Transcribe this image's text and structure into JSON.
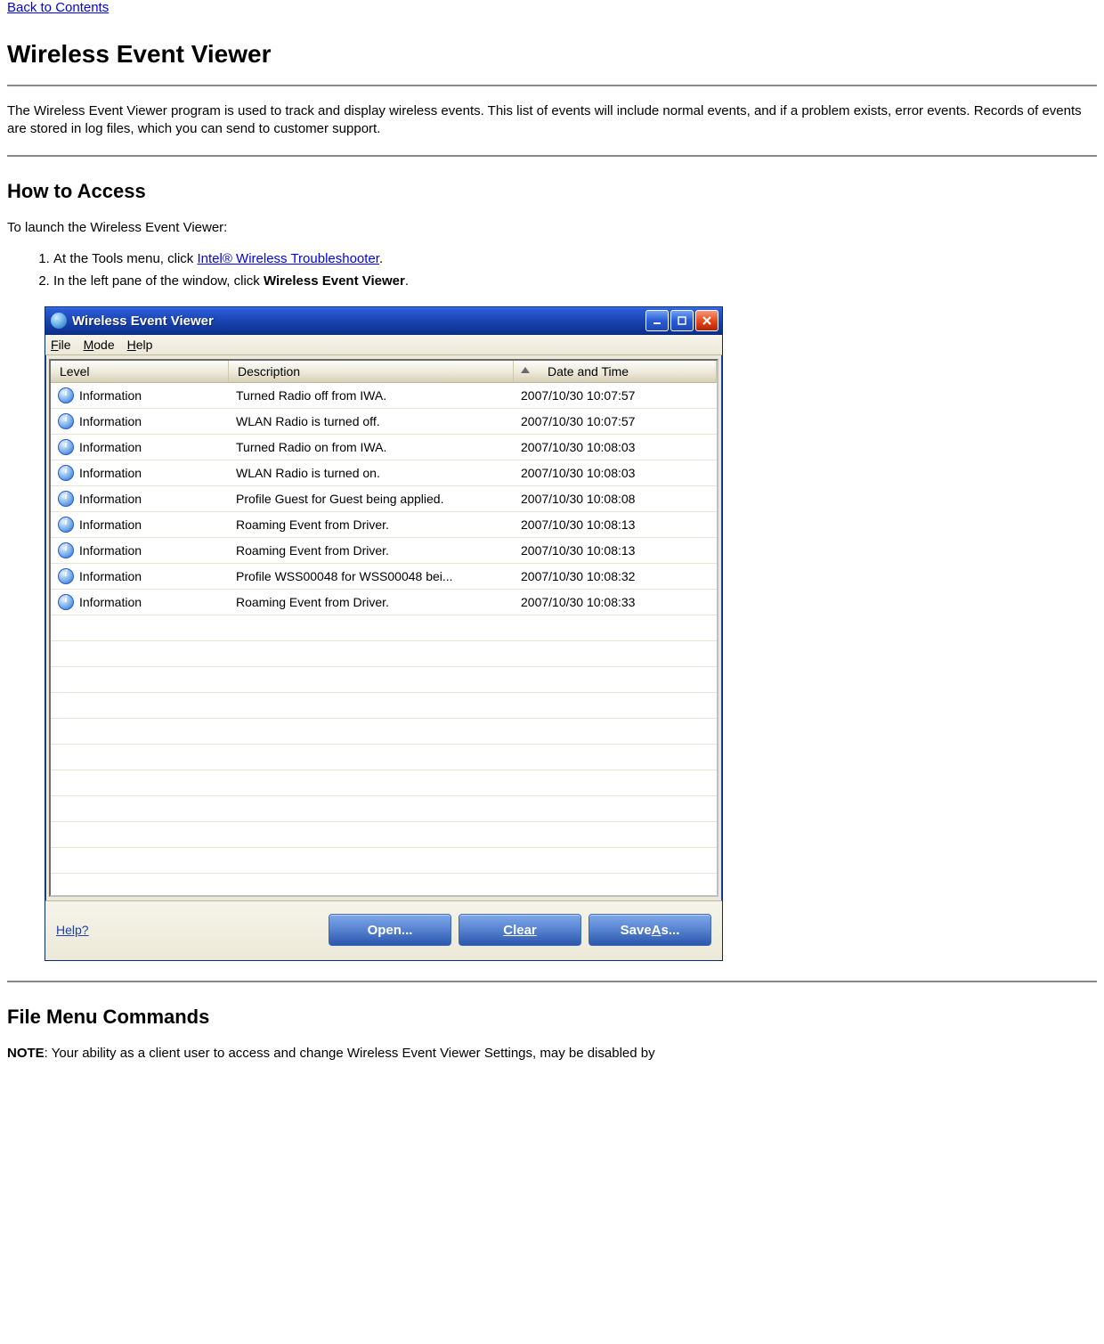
{
  "nav": {
    "back_link": "Back to Contents"
  },
  "h1": "Wireless Event Viewer",
  "intro": "The Wireless Event Viewer program is used to track and display wireless events. This list of events will include normal events, and if a problem exists, error events. Records of events are stored in log files, which you can send to customer support.",
  "how_to_access": {
    "heading": "How to Access",
    "lead": "To launch the Wireless Event Viewer:",
    "steps": [
      {
        "prefix": "At the Tools menu, click ",
        "link": "Intel® Wireless Troubleshooter",
        "suffix": "."
      },
      {
        "prefix": "In the left pane of the window, click ",
        "bold": "Wireless Event Viewer",
        "suffix": "."
      }
    ]
  },
  "screenshot": {
    "window_title": "Wireless Event Viewer",
    "menubar": [
      {
        "label": "File",
        "accel": "F"
      },
      {
        "label": "Mode",
        "accel": "M"
      },
      {
        "label": "Help",
        "accel": "H"
      }
    ],
    "columns": {
      "level": "Level",
      "description": "Description",
      "date": "Date and Time"
    },
    "rows": [
      {
        "level": "Information",
        "desc": "Turned Radio off from IWA.",
        "date": "2007/10/30 10:07:57"
      },
      {
        "level": "Information",
        "desc": "WLAN Radio is turned off.",
        "date": "2007/10/30 10:07:57"
      },
      {
        "level": "Information",
        "desc": "Turned Radio on from IWA.",
        "date": "2007/10/30 10:08:03"
      },
      {
        "level": "Information",
        "desc": "WLAN Radio is turned on.",
        "date": "2007/10/30 10:08:03"
      },
      {
        "level": "Information",
        "desc": "Profile Guest for Guest being applied.",
        "date": "2007/10/30 10:08:08"
      },
      {
        "level": "Information",
        "desc": "Roaming Event from Driver.",
        "date": "2007/10/30 10:08:13"
      },
      {
        "level": "Information",
        "desc": "Roaming Event from Driver.",
        "date": "2007/10/30 10:08:13"
      },
      {
        "level": "Information",
        "desc": "Profile WSS00048 for WSS00048 bei...",
        "date": "2007/10/30 10:08:32"
      },
      {
        "level": "Information",
        "desc": "Roaming Event from Driver.",
        "date": "2007/10/30 10:08:33"
      }
    ],
    "empty_rows": 10,
    "footer": {
      "help": "Help?",
      "open": "Open...",
      "clear": "Clear",
      "saveas_prefix": "Save ",
      "saveas_accel": "A",
      "saveas_suffix": "s..."
    }
  },
  "file_menu": {
    "heading": "File Menu Commands",
    "note_label": "NOTE",
    "note_text": ": Your ability as a client user to access and change Wireless Event Viewer Settings, may be disabled by"
  }
}
